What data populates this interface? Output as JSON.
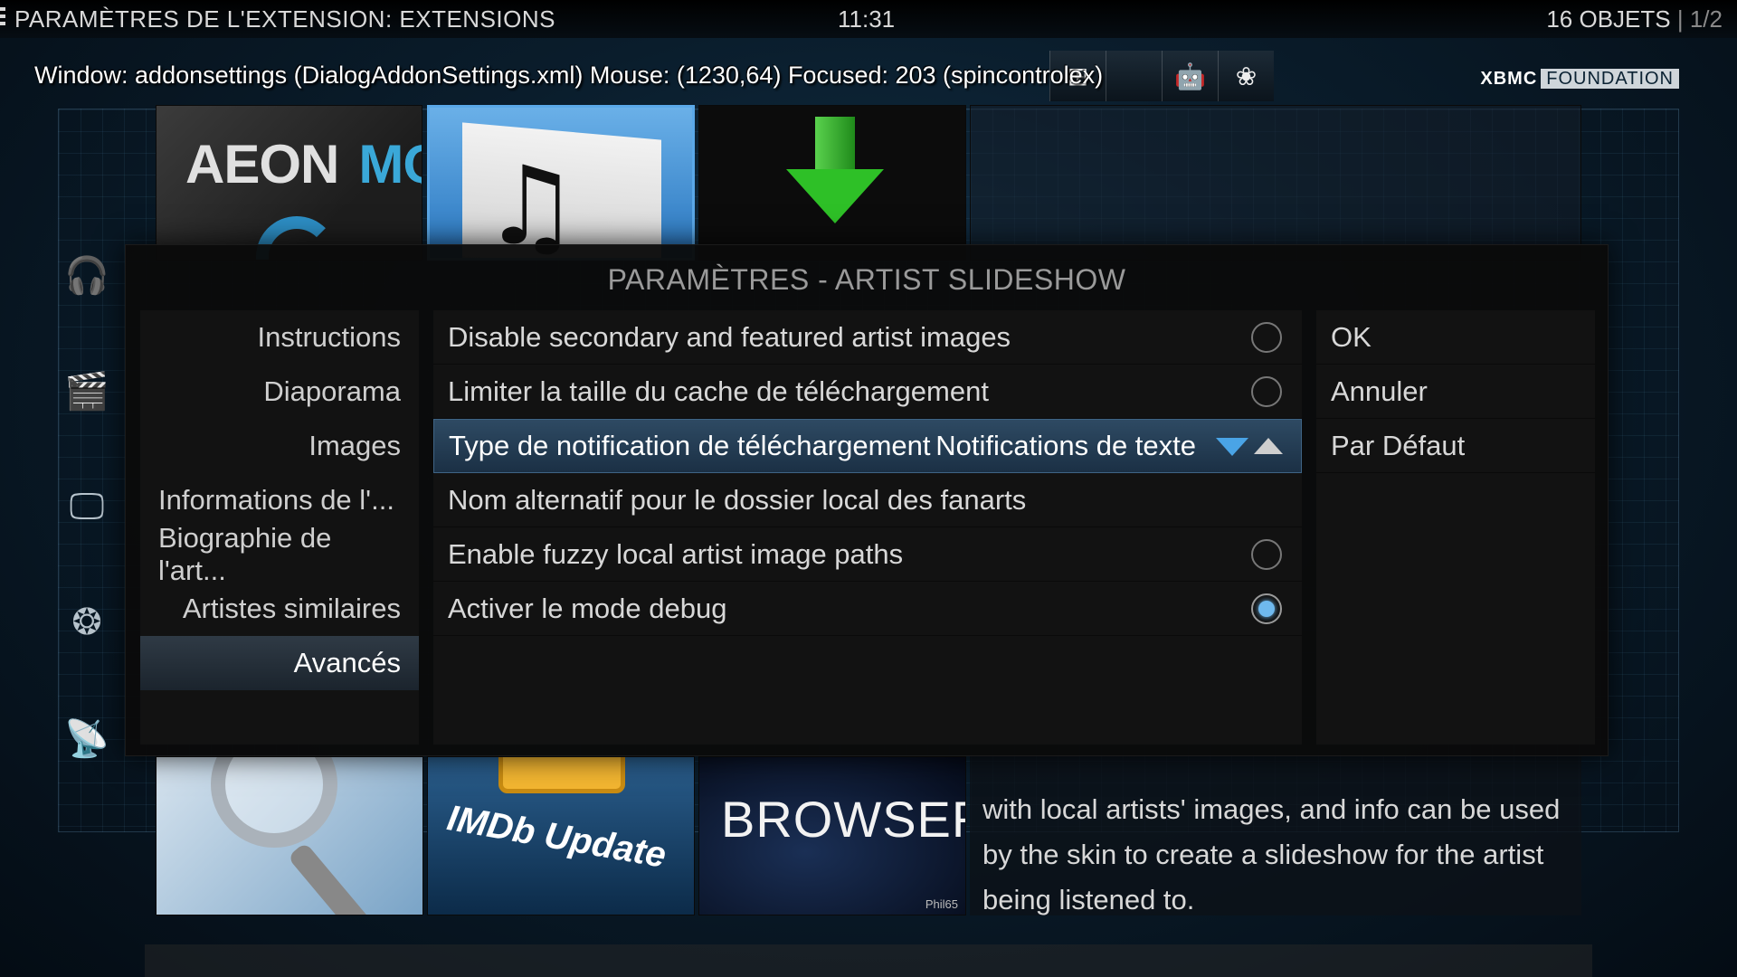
{
  "header": {
    "title": "PARAMÈTRES DE L'EXTENSION: EXTENSIONS",
    "clock": "11:31",
    "count": "16 OBJETS",
    "page": "1/2"
  },
  "debug_overlay": "Window: addonsettings (DialogAddonSettings.xml)  Mouse: (1230,64)  Focused: 203 (spincontrolex)",
  "branding": {
    "logo": "XBMC",
    "foundation": "FOUNDATION"
  },
  "platform_icons": [
    "windows-icon",
    "apple-icon",
    "android-icon",
    "raspberry-pi-icon"
  ],
  "sidebar_icons": [
    "headphones-icon",
    "film-clapper-icon",
    "tv-icon",
    "aperture-icon",
    "satellite-icon"
  ],
  "thumbnails": {
    "aeon": {
      "line1": "AEON",
      "line2": "MQ"
    },
    "imdb": "IMDb Update",
    "maps": {
      "title": "BROWSER",
      "signature": "Phil65"
    }
  },
  "description": "with local artists' images, and info can be used by the skin to create a slideshow for the artist being listened to.",
  "dialog": {
    "title": "PARAMÈTRES - ARTIST SLIDESHOW",
    "categories": [
      {
        "label": "Instructions"
      },
      {
        "label": "Diaporama"
      },
      {
        "label": "Images"
      },
      {
        "label": "Informations de l'..."
      },
      {
        "label": "Biographie de l'art..."
      },
      {
        "label": "Artistes similaires"
      },
      {
        "label": "Avancés"
      }
    ],
    "settings": [
      {
        "label": "Disable secondary and featured artist images",
        "type": "radio",
        "checked": false
      },
      {
        "label": "Limiter la taille du cache de téléchargement",
        "type": "radio",
        "checked": false
      },
      {
        "label": "Type de notification de téléchargement",
        "type": "spin",
        "value": "Notifications de texte"
      },
      {
        "label": "Nom alternatif pour le dossier local des fanarts",
        "type": "text"
      },
      {
        "label": "Enable fuzzy local artist image paths",
        "type": "radio",
        "checked": false
      },
      {
        "label": "Activer le mode debug",
        "type": "radio",
        "checked": true
      }
    ],
    "buttons": [
      {
        "label": "OK"
      },
      {
        "label": "Annuler"
      },
      {
        "label": "Par Défaut"
      }
    ]
  },
  "colors": {
    "accent": "#4aa4e6",
    "focus_bg": "#2e4a63",
    "dialog_bg": "#0a0a0a"
  }
}
